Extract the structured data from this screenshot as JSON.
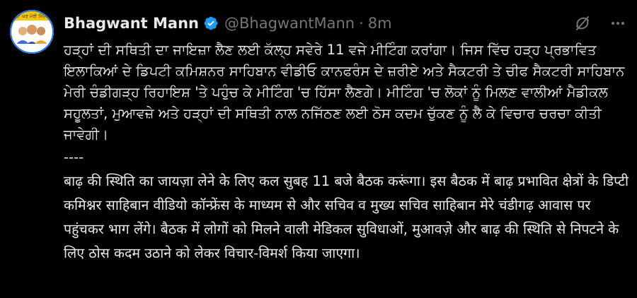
{
  "avatar": {
    "caption": "ਮੇਰਾ ਘਰ ਮੇਰੀ ਜ਼ਿੰਦਗੀ",
    "colors": {
      "banner": "#f6c400",
      "border": "#1d6ff2"
    }
  },
  "author": {
    "display_name": "Bhagwant Mann",
    "handle": "@BhagwantMann",
    "separator": "·",
    "time": "8m",
    "verified_color": "#1d9bf0"
  },
  "actions": [
    {
      "name": "grok-icon"
    },
    {
      "name": "more-icon"
    }
  ],
  "post": {
    "punjabi": "ਹੜ੍ਹਾਂ ਦੀ ਸਥਿਤੀ ਦਾ ਜਾਇਜ਼ਾ ਲੈਣ ਲਈ ਕੱਲ੍ਹ ਸਵੇਰੇ 11 ਵਜੇ ਮੀਟਿੰਗ ਕਰਾਂਗਾ। ਜਿਸ ਵਿੱਚ ਹੜ੍ਹ ਪ੍ਰਭਾਵਿਤ ਇਲਾਕਿਆਂ ਦੇ ਡਿਪਟੀ ਕਮਿਸ਼ਨਰ ਸਾਹਿਬਾਨ ਵੀਡੀਓ ਕਾਨਫਰੰਸ ਦੇ ਜ਼ਰੀਏ ਅਤੇ ਸੈਕਟਰੀ ਤੇ ਚੀਫ ਸੈਕਟਰੀ ਸਾਹਿਬਾਨ ਮੇਰੀ ਚੰਡੀਗੜ੍ਹ ਰਿਹਾਇਸ਼ 'ਤੇ ਪਹੁੰਚ ਕੇ ਮੀਟਿੰਗ 'ਚ ਹਿੱਸਾ ਲੈਣਗੇ। ਮੀਟਿੰਗ 'ਚ ਲੋਕਾਂ ਨੂੰ ਮਿਲਣ ਵਾਲੀਆਂ ਮੈਡੀਕਲ ਸਹੂਲਤਾਂ, ਮੁਆਵਜ਼ੇ ਅਤੇ ਹੜ੍ਹਾਂ ਦੀ ਸਥਿਤੀ ਨਾਲ ਨਜਿੱਠਣ ਲਈ ਠੋਸ ਕਦਮ ਚੁੱਕਣ ਨੂੰ ਲੈ ਕੇ ਵਿਚਾਰ ਚਰਚਾ ਕੀਤੀ ਜਾਵੇਗੀ।",
    "separator": "----",
    "hindi": "बाढ़ की स्थिति का जायज़ा लेने के लिए कल सुबह 11 बजे बैठक करूंगा। इस बैठक में बाढ़ प्रभावित क्षेत्रों के डिप्टी कमिश्नर साहिबान वीडियो कॉन्फ्रेंस के माध्यम से और सचिव व मुख्य सचिव साहिबान मेरे चंडीगढ़ आवास पर पहुंचकर भाग लेंगे। बैठक में लोगों को मिलने वाली मेडिकल सुविधाओं, मुआवज़े और बाढ़ की स्थिति से निपटने के लिए ठोस कदम उठाने को लेकर विचार-विमर्श किया जाएगा।"
  }
}
